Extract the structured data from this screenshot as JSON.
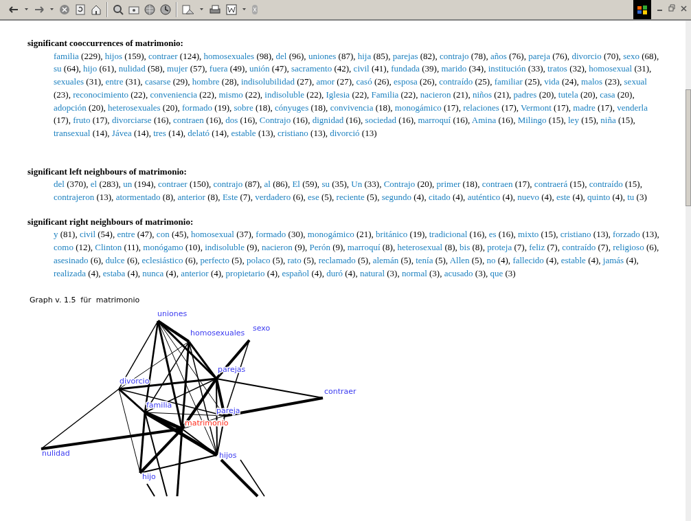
{
  "sections": [
    {
      "heading": "significant cooccurrences of matrimonio:",
      "items": [
        {
          "word": "familia",
          "count": "(229),"
        },
        {
          "word": "hijos",
          "count": "(159),"
        },
        {
          "word": "contraer",
          "count": "(124),"
        },
        {
          "word": "homosexuales",
          "count": "(98),"
        },
        {
          "word": "del",
          "count": "(96),"
        },
        {
          "word": "uniones",
          "count": "(87),"
        },
        {
          "word": "hija",
          "count": "(85),"
        },
        {
          "word": "parejas",
          "count": "(82),"
        },
        {
          "word": "contrajo",
          "count": "(78),"
        },
        {
          "word": "años",
          "count": "(76),"
        },
        {
          "word": "pareja",
          "count": "(76),"
        },
        {
          "word": "divorcio",
          "count": "(70),"
        },
        {
          "word": "sexo",
          "count": "(68),"
        },
        {
          "word": "su",
          "count": "(64),"
        },
        {
          "word": "hijo",
          "count": "(61),"
        },
        {
          "word": "nulidad",
          "count": "(58),"
        },
        {
          "word": "mujer",
          "count": "(57),"
        },
        {
          "word": "fuera",
          "count": "(49),"
        },
        {
          "word": "unión",
          "count": "(47),"
        },
        {
          "word": "sacramento",
          "count": "(42),"
        },
        {
          "word": "civil",
          "count": "(41),"
        },
        {
          "word": "fundada",
          "count": "(39),"
        },
        {
          "word": "marido",
          "count": "(34),"
        },
        {
          "word": "institución",
          "count": "(33),"
        },
        {
          "word": "tratos",
          "count": "(32),"
        },
        {
          "word": "homosexual",
          "count": "(31),"
        },
        {
          "word": "sexuales",
          "count": "(31),"
        },
        {
          "word": "entre",
          "count": "(31),"
        },
        {
          "word": "casarse",
          "count": "(29),"
        },
        {
          "word": "hombre",
          "count": "(28),"
        },
        {
          "word": "indisolubilidad",
          "count": "(27),"
        },
        {
          "word": "amor",
          "count": "(27),"
        },
        {
          "word": "casó",
          "count": "(26),"
        },
        {
          "word": "esposa",
          "count": "(26),"
        },
        {
          "word": "contraído",
          "count": "(25),"
        },
        {
          "word": "familiar",
          "count": "(25),"
        },
        {
          "word": "vida",
          "count": "(24),"
        },
        {
          "word": "malos",
          "count": "(23),"
        },
        {
          "word": "sexual",
          "count": "(23),"
        },
        {
          "word": "reconocimiento",
          "count": "(22),"
        },
        {
          "word": "conveniencia",
          "count": "(22),"
        },
        {
          "word": "mismo",
          "count": "(22),"
        },
        {
          "word": "indisoluble",
          "count": "(22),"
        },
        {
          "word": "Iglesia",
          "count": "(22),"
        },
        {
          "word": "Familia",
          "count": "(22),"
        },
        {
          "word": "nacieron",
          "count": "(21),"
        },
        {
          "word": "niños",
          "count": "(21),"
        },
        {
          "word": "padres",
          "count": "(20),"
        },
        {
          "word": "tutela",
          "count": "(20),"
        },
        {
          "word": "casa",
          "count": "(20),"
        },
        {
          "word": "adopción",
          "count": "(20),"
        },
        {
          "word": "heterosexuales",
          "count": "(20),"
        },
        {
          "word": "formado",
          "count": "(19),"
        },
        {
          "word": "sobre",
          "count": "(18),"
        },
        {
          "word": "cónyuges",
          "count": "(18),"
        },
        {
          "word": "convivencia",
          "count": "(18),"
        },
        {
          "word": "monogámico",
          "count": "(17),"
        },
        {
          "word": "relaciones",
          "count": "(17),"
        },
        {
          "word": "Vermont",
          "count": "(17),"
        },
        {
          "word": "madre",
          "count": "(17),"
        },
        {
          "word": "venderla",
          "count": "(17),"
        },
        {
          "word": "fruto",
          "count": "(17),"
        },
        {
          "word": "divorciarse",
          "count": "(16),"
        },
        {
          "word": "contraen",
          "count": "(16),"
        },
        {
          "word": "dos",
          "count": "(16),"
        },
        {
          "word": "Contrajo",
          "count": "(16),"
        },
        {
          "word": "dignidad",
          "count": "(16),"
        },
        {
          "word": "sociedad",
          "count": "(16),"
        },
        {
          "word": "marroquí",
          "count": "(16),"
        },
        {
          "word": "Amina",
          "count": "(16),"
        },
        {
          "word": "Milingo",
          "count": "(15),"
        },
        {
          "word": "ley",
          "count": "(15),"
        },
        {
          "word": "niña",
          "count": "(15),"
        },
        {
          "word": "transexual",
          "count": "(14),"
        },
        {
          "word": "Jávea",
          "count": "(14),"
        },
        {
          "word": "tres",
          "count": "(14),"
        },
        {
          "word": "delató",
          "count": "(14),"
        },
        {
          "word": "estable",
          "count": "(13),"
        },
        {
          "word": "cristiano",
          "count": "(13),"
        },
        {
          "word": "divorció",
          "count": "(13)"
        }
      ]
    },
    {
      "heading": "significant left neighbours of matrimonio:",
      "items": [
        {
          "word": "del",
          "count": "(370),"
        },
        {
          "word": "el",
          "count": "(283),"
        },
        {
          "word": "un",
          "count": "(194),"
        },
        {
          "word": "contraer",
          "count": "(150),"
        },
        {
          "word": "contrajo",
          "count": "(87),"
        },
        {
          "word": "al",
          "count": "(86),"
        },
        {
          "word": "El",
          "count": "(59),"
        },
        {
          "word": "su",
          "count": "(35),"
        },
        {
          "word": "Un",
          "count": "(33),"
        },
        {
          "word": "Contrajo",
          "count": "(20),"
        },
        {
          "word": "primer",
          "count": "(18),"
        },
        {
          "word": "contraen",
          "count": "(17),"
        },
        {
          "word": "contraerá",
          "count": "(15),"
        },
        {
          "word": "contraído",
          "count": "(15),"
        },
        {
          "word": "contrajeron",
          "count": "(13),"
        },
        {
          "word": "atormentado",
          "count": "(8),"
        },
        {
          "word": "anterior",
          "count": "(8),"
        },
        {
          "word": "Este",
          "count": "(7),"
        },
        {
          "word": "verdadero",
          "count": "(6),"
        },
        {
          "word": "ese",
          "count": "(5),"
        },
        {
          "word": "reciente",
          "count": "(5),"
        },
        {
          "word": "segundo",
          "count": "(4),"
        },
        {
          "word": "citado",
          "count": "(4),"
        },
        {
          "word": "auténtico",
          "count": "(4),"
        },
        {
          "word": "nuevo",
          "count": "(4),"
        },
        {
          "word": "este",
          "count": "(4),"
        },
        {
          "word": "quinto",
          "count": "(4),"
        },
        {
          "word": "tu",
          "count": "(3)"
        }
      ]
    },
    {
      "heading": "significant right neighbours of matrimonio:",
      "items": [
        {
          "word": "y",
          "count": "(81),"
        },
        {
          "word": "civil",
          "count": "(54),"
        },
        {
          "word": "entre",
          "count": "(47),"
        },
        {
          "word": "con",
          "count": "(45),"
        },
        {
          "word": "homosexual",
          "count": "(37),"
        },
        {
          "word": "formado",
          "count": "(30),"
        },
        {
          "word": "monogámico",
          "count": "(21),"
        },
        {
          "word": "británico",
          "count": "(19),"
        },
        {
          "word": "tradicional",
          "count": "(16),"
        },
        {
          "word": "es",
          "count": "(16),"
        },
        {
          "word": "mixto",
          "count": "(15),"
        },
        {
          "word": "cristiano",
          "count": "(13),"
        },
        {
          "word": "forzado",
          "count": "(13),"
        },
        {
          "word": "como",
          "count": "(12),"
        },
        {
          "word": "Clinton",
          "count": "(11),"
        },
        {
          "word": "monógamo",
          "count": "(10),"
        },
        {
          "word": "indisoluble",
          "count": "(9),"
        },
        {
          "word": "nacieron",
          "count": "(9),"
        },
        {
          "word": "Perón",
          "count": "(9),"
        },
        {
          "word": "marroquí",
          "count": "(8),"
        },
        {
          "word": "heterosexual",
          "count": "(8),"
        },
        {
          "word": "bis",
          "count": "(8),"
        },
        {
          "word": "proteja",
          "count": "(7),"
        },
        {
          "word": "feliz",
          "count": "(7),"
        },
        {
          "word": "contraído",
          "count": "(7),"
        },
        {
          "word": "religioso",
          "count": "(6),"
        },
        {
          "word": "asesinado",
          "count": "(6),"
        },
        {
          "word": "dulce",
          "count": "(6),"
        },
        {
          "word": "eclesiástico",
          "count": "(6),"
        },
        {
          "word": "perfecto",
          "count": "(5),"
        },
        {
          "word": "polaco",
          "count": "(5),"
        },
        {
          "word": "rato",
          "count": "(5),"
        },
        {
          "word": "reclamado",
          "count": "(5),"
        },
        {
          "word": "alemán",
          "count": "(5),"
        },
        {
          "word": "tenía",
          "count": "(5),"
        },
        {
          "word": "Allen",
          "count": "(5),"
        },
        {
          "word": "no",
          "count": "(4),"
        },
        {
          "word": "fallecido",
          "count": "(4),"
        },
        {
          "word": "estable",
          "count": "(4),"
        },
        {
          "word": "jamás",
          "count": "(4),"
        },
        {
          "word": "realizada",
          "count": "(4),"
        },
        {
          "word": "estaba",
          "count": "(4),"
        },
        {
          "word": "nunca",
          "count": "(4),"
        },
        {
          "word": "anterior",
          "count": "(4),"
        },
        {
          "word": "propietario",
          "count": "(4),"
        },
        {
          "word": "español",
          "count": "(4),"
        },
        {
          "word": "duró",
          "count": "(4),"
        },
        {
          "word": "natural",
          "count": "(3),"
        },
        {
          "word": "normal",
          "count": "(3),"
        },
        {
          "word": "acusado",
          "count": "(3),"
        },
        {
          "word": "que",
          "count": "(3)"
        }
      ]
    }
  ],
  "graph": {
    "title": "Graph v. 1.5  für  matrimonio",
    "nodes": [
      {
        "label": "uniones",
        "kind": "neighbour"
      },
      {
        "label": "homosexuales",
        "kind": "neighbour"
      },
      {
        "label": "sexo",
        "kind": "neighbour"
      },
      {
        "label": "parejas",
        "kind": "neighbour"
      },
      {
        "label": "divorcio",
        "kind": "neighbour"
      },
      {
        "label": "contraer",
        "kind": "neighbour"
      },
      {
        "label": "familia",
        "kind": "neighbour"
      },
      {
        "label": "pareja",
        "kind": "neighbour"
      },
      {
        "label": "matrimonio",
        "kind": "center"
      },
      {
        "label": "nulidad",
        "kind": "neighbour"
      },
      {
        "label": "hijos",
        "kind": "neighbour"
      },
      {
        "label": "hijo",
        "kind": "neighbour"
      }
    ]
  }
}
